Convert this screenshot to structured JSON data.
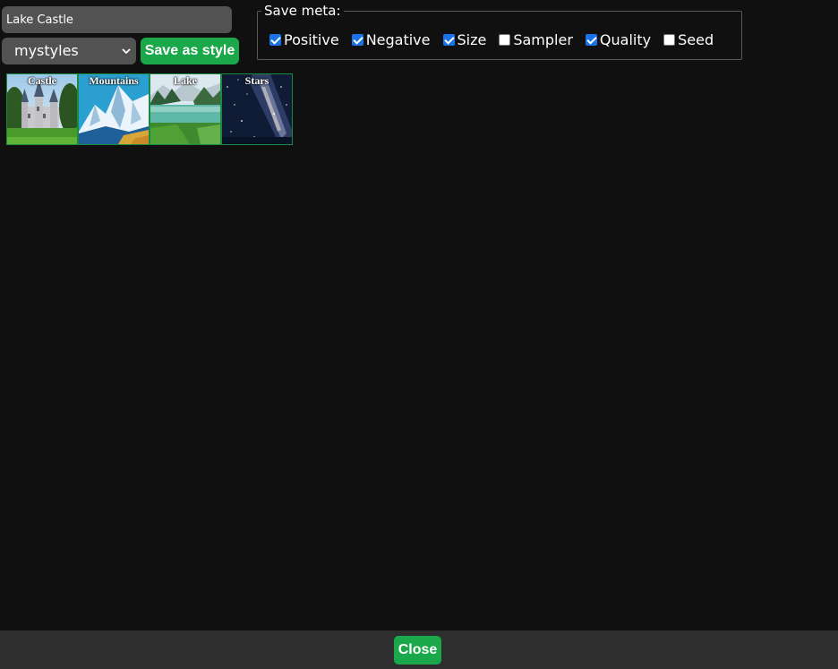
{
  "style_name_input": {
    "value": "Lake Castle"
  },
  "style_select": {
    "selected": "mystyles"
  },
  "save_style_button": {
    "label": "Save as style"
  },
  "save_meta": {
    "legend": "Save meta:",
    "options": [
      {
        "label": "Positive",
        "checked": true
      },
      {
        "label": "Negative",
        "checked": true
      },
      {
        "label": "Size",
        "checked": true
      },
      {
        "label": "Sampler",
        "checked": false
      },
      {
        "label": "Quality",
        "checked": true
      },
      {
        "label": "Seed",
        "checked": false
      }
    ]
  },
  "gallery": {
    "items": [
      {
        "label": "Castle"
      },
      {
        "label": "Mountains"
      },
      {
        "label": "Lake"
      },
      {
        "label": "Stars"
      }
    ]
  },
  "footer": {
    "close_label": "Close"
  },
  "colors": {
    "background": "#101010",
    "input_bg": "#525252",
    "accent_green": "#1aa84a",
    "checkbox_checked": "#1a73e8",
    "footer_bg": "#2e2e2e"
  }
}
